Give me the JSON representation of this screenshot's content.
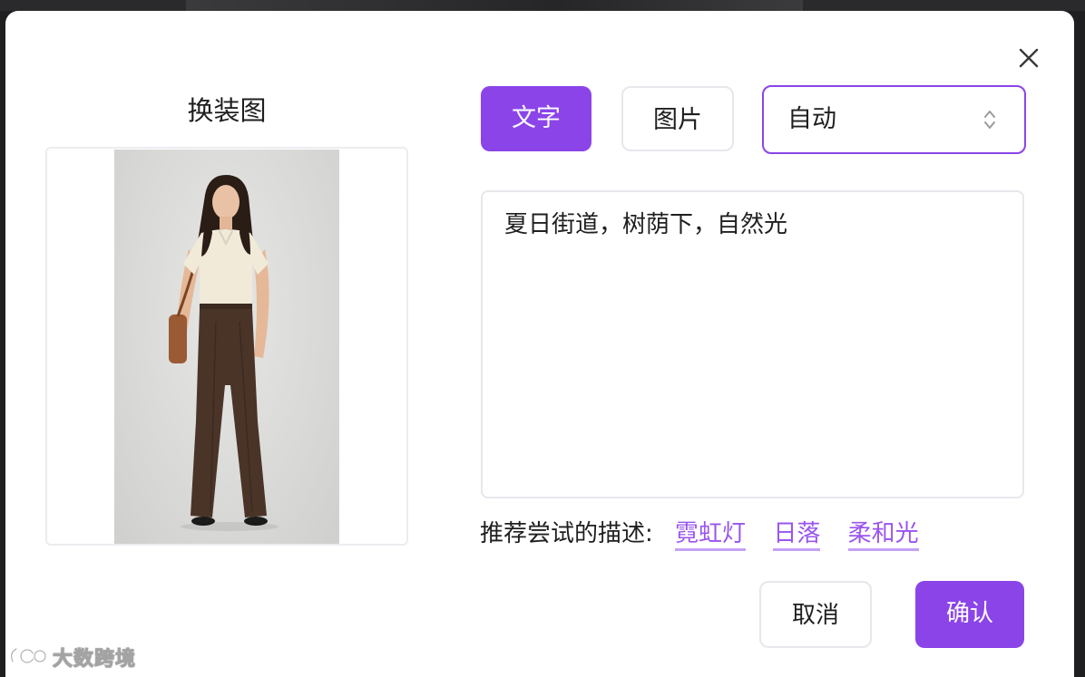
{
  "modal": {
    "left_title": "换装图",
    "tabs": [
      {
        "label": "文字",
        "active": true
      },
      {
        "label": "图片",
        "active": false
      }
    ],
    "mode_select": {
      "value": "自动"
    },
    "prompt": {
      "value": "夏日街道，树荫下，自然光"
    },
    "suggestions": {
      "label": "推荐尝试的描述:",
      "items": [
        "霓虹灯",
        "日落",
        "柔和光"
      ]
    },
    "buttons": {
      "cancel": "取消",
      "confirm": "确认"
    }
  },
  "watermark": {
    "text": "大数跨境"
  },
  "colors": {
    "accent": "#8b44e8",
    "link": "#9a55ee",
    "border": "#e7e7ec"
  },
  "icons": {
    "close": "close-icon",
    "select_arrows": "chevron-up-down-icon",
    "watermark_logo": "logo-icon"
  }
}
